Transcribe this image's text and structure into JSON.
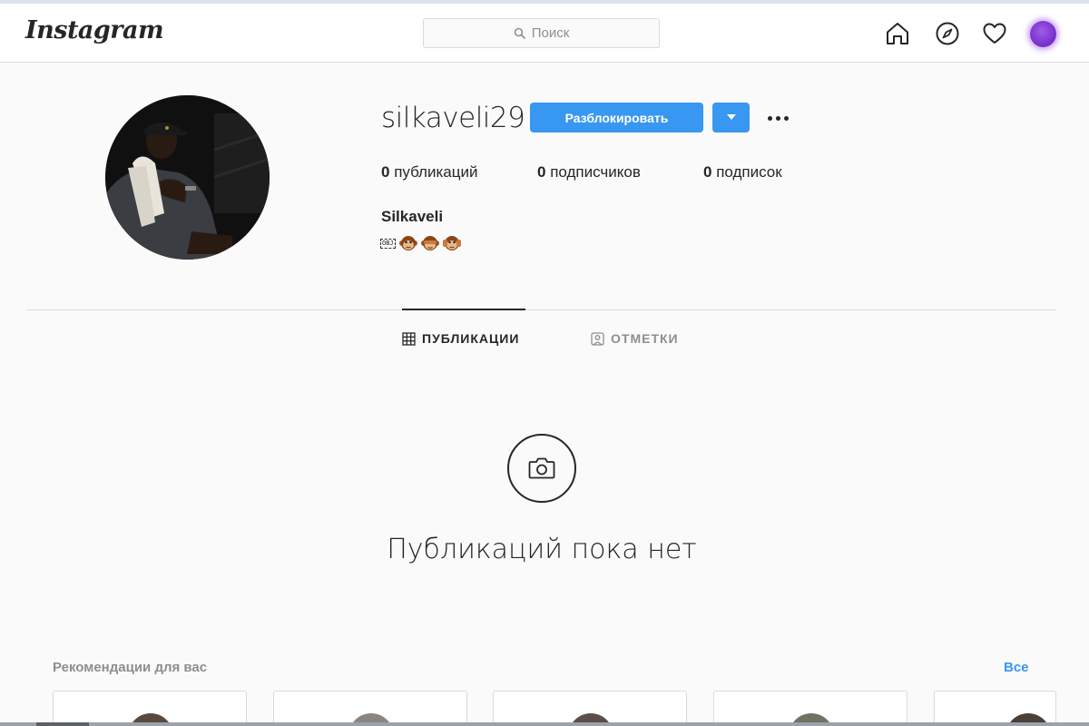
{
  "header": {
    "logo": "Instagram",
    "search_placeholder": "Поиск",
    "nav_icons": [
      "home-icon",
      "explore-icon",
      "heart-icon",
      "avatar"
    ]
  },
  "profile": {
    "username": "silkaveli29",
    "unblock_label": "Разблокировать",
    "posts_count": "0",
    "posts_label": " публикаций",
    "followers_count": "0",
    "followers_label": " подписчиков",
    "following_count": "0",
    "following_label": " подписок",
    "full_name": "Silkaveli",
    "bio_obj": "OBJ",
    "bio_emojis": [
      "monkey-icon",
      "see-no-evil-monkey-icon",
      "hear-no-evil-monkey-icon"
    ]
  },
  "tabs": [
    {
      "label": "ПУБЛИКАЦИИ",
      "active": true,
      "icon": "grid-icon"
    },
    {
      "label": "ОТМЕТКИ",
      "active": false,
      "icon": "tag-person-icon"
    }
  ],
  "empty_state": {
    "icon": "camera-icon",
    "text": "Публикаций пока нет"
  },
  "recommendations": {
    "title": "Рекомендации для вас",
    "see_all": "Все"
  },
  "colors": {
    "accent": "#3897f0",
    "text": "#262626",
    "muted": "#8e8e8e",
    "border": "#dbdbdb",
    "background": "#fafafa"
  }
}
